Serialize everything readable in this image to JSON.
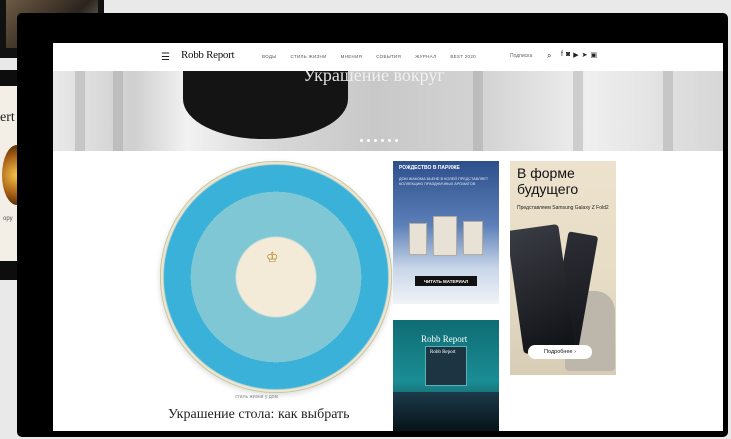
{
  "background_windows": {
    "left_panel_text": "ert",
    "left_panel_small": "ору"
  },
  "header": {
    "logo": "Robb Report",
    "nav": [
      "ВОДЫ",
      "СТИЛЬ ЖИЗНИ",
      "МНЕНИЯ",
      "СОБЫТИЯ",
      "ЖУРНАЛ",
      "BEST 2020"
    ],
    "subscribe": "Подписка",
    "search_icon": "search-icon",
    "social_icons": [
      "facebook-icon",
      "instagram-icon",
      "youtube-icon",
      "telegram-icon",
      "vk-icon"
    ]
  },
  "hero": {
    "title": "Украшение вокруг"
  },
  "article": {
    "category": "стиль жизни у дом",
    "headline": "Украшение стола: как выбрать"
  },
  "ads": {
    "ad1": {
      "title": "РОЖДЕСТВО В ПАРИЖЕ",
      "text": "ДОМ ЖАКОМА БЬЕНЕ В КОЛЕЙ ПРЕДСТАВЛЯЕТ КОЛЛЕКЦИЮ ПРАЗДНИЧНЫХ АРОМАТОВ",
      "button": "ЧИТАТЬ МАТЕРИАЛ"
    },
    "ad2": {
      "logo": "Robb Report",
      "mini_logo": "Robb Report"
    },
    "ad3": {
      "title": "В форме будущего",
      "subtitle": "Представляем Samsung Galaxy Z Fold2",
      "button": "Подробнее ›"
    }
  }
}
